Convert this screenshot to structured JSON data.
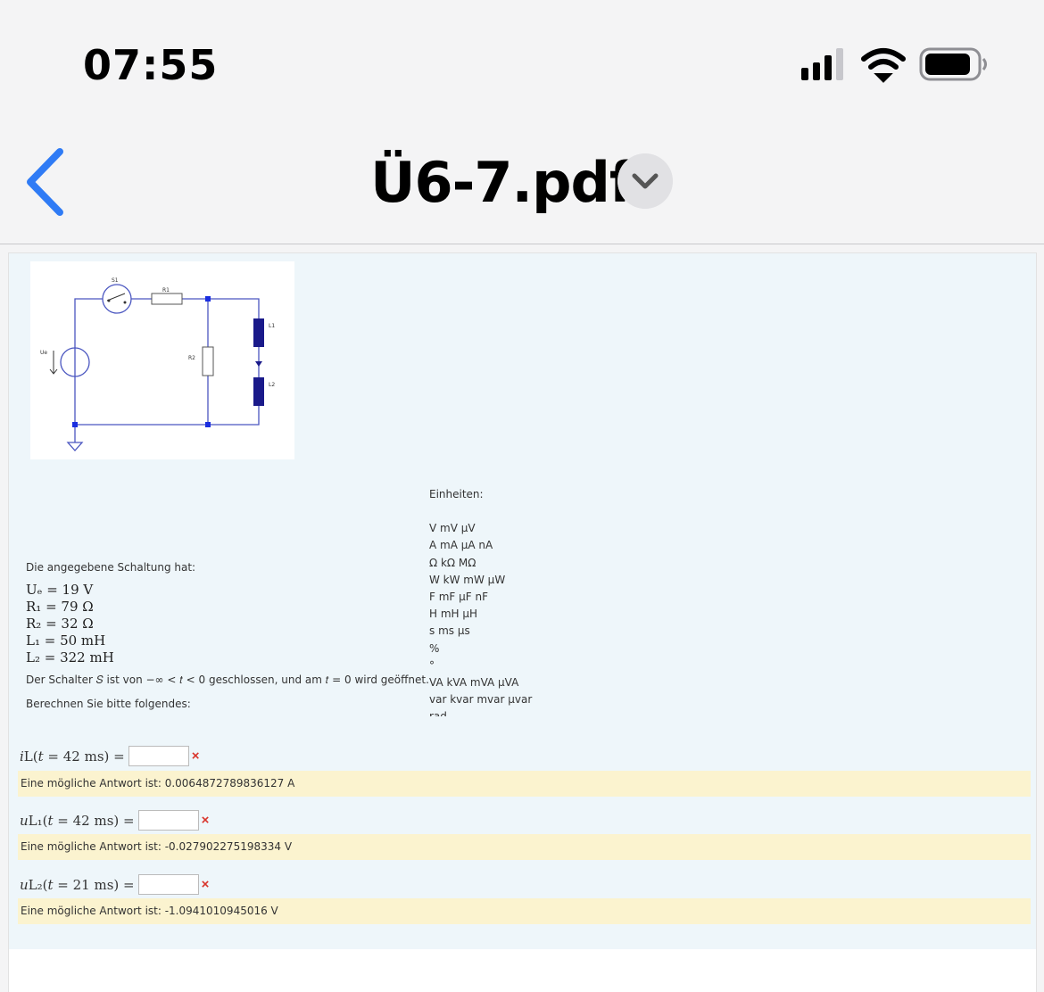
{
  "status": {
    "time": "07:55"
  },
  "nav": {
    "title": "Ü6-7.pdf"
  },
  "figure": {
    "labels": {
      "s1": "S1",
      "r1": "R1",
      "r2": "R2",
      "l1": "L1",
      "l2": "L2",
      "ue": "Ue"
    }
  },
  "content": {
    "intro": "Die angegebene Schaltung hat:",
    "vars": [
      "Uₑ = 19 V",
      "R₁ = 79 Ω",
      "R₂ = 32 Ω",
      "L₁ = 50 mH",
      "L₂ = 322 mH"
    ],
    "switch_text": "Der Schalter 𝑆 ist von −∞ < 𝑡 < 0 geschlossen, und am 𝑡 = 0 wird geöffnet.",
    "ask": "Berechnen Sie bitte folgendes:"
  },
  "units": {
    "heading": "Einheiten:",
    "rows": [
      "V mV µV",
      "A mA µA nA",
      "Ω kΩ MΩ",
      "W kW mW µW",
      "F mF µF nF",
      "H mH µH",
      "s ms µs",
      "%",
      "°",
      "VA kVA mVA µVA",
      "var kvar mvar µvar",
      "rad"
    ]
  },
  "questions": [
    {
      "label": "𝑖L(𝑡 = 42 ms) =",
      "mark": "×",
      "answer": "Eine mögliche Antwort ist: 0.0064872789836127 A"
    },
    {
      "label": "𝑢L₁(𝑡 = 42 ms) =",
      "mark": "×",
      "answer": "Eine mögliche Antwort ist: -0.027902275198334 V"
    },
    {
      "label": "𝑢L₂(𝑡 = 21 ms) =",
      "mark": "×",
      "answer": "Eine mögliche Antwort ist: -1.0941010945016 V"
    }
  ]
}
